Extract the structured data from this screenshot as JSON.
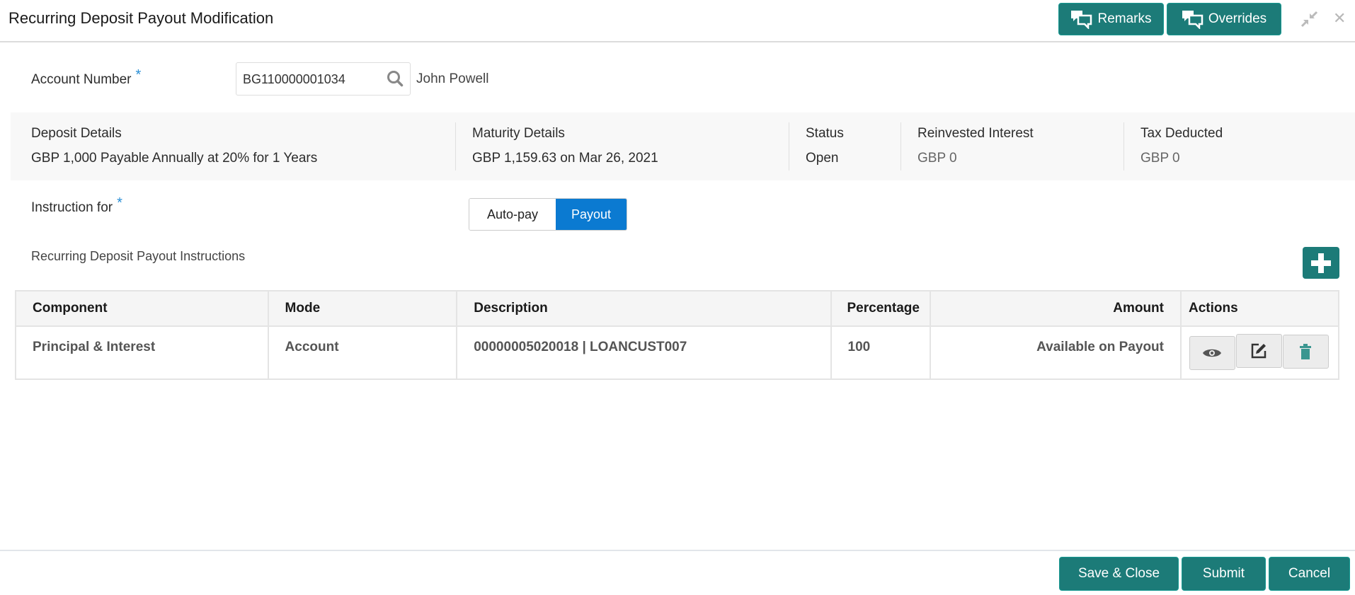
{
  "header": {
    "title": "Recurring Deposit Payout Modification",
    "remarks": "Remarks",
    "overrides": "Overrides"
  },
  "account": {
    "label": "Account Number",
    "required": "*",
    "value": "BG110000001034",
    "customer": "John Powell"
  },
  "summary": [
    {
      "label": "Deposit Details",
      "value": "GBP 1,000 Payable Annually at 20% for 1 Years"
    },
    {
      "label": "Maturity Details",
      "value": "GBP 1,159.63 on Mar 26, 2021"
    },
    {
      "label": "Status",
      "value": "Open"
    },
    {
      "label": "Reinvested Interest",
      "value": "GBP 0"
    },
    {
      "label": "Tax Deducted",
      "value": "GBP 0"
    }
  ],
  "instruction": {
    "label": "Instruction for",
    "required": "*",
    "options": [
      "Auto-pay",
      "Payout"
    ],
    "selected": "Payout"
  },
  "section_title": "Recurring Deposit Payout Instructions",
  "table": {
    "headers": [
      "Component",
      "Mode",
      "Description",
      "Percentage",
      "Amount",
      "Actions"
    ],
    "rows": [
      {
        "component": "Principal & Interest",
        "mode": "Account",
        "description": "00000005020018 | LOANCUST007",
        "percentage": "100",
        "amount": "Available on Payout"
      }
    ]
  },
  "footer": {
    "save": "Save & Close",
    "submit": "Submit",
    "cancel": "Cancel"
  },
  "colors": {
    "teal": "#1c7b78",
    "blue": "#0b7ad1"
  }
}
